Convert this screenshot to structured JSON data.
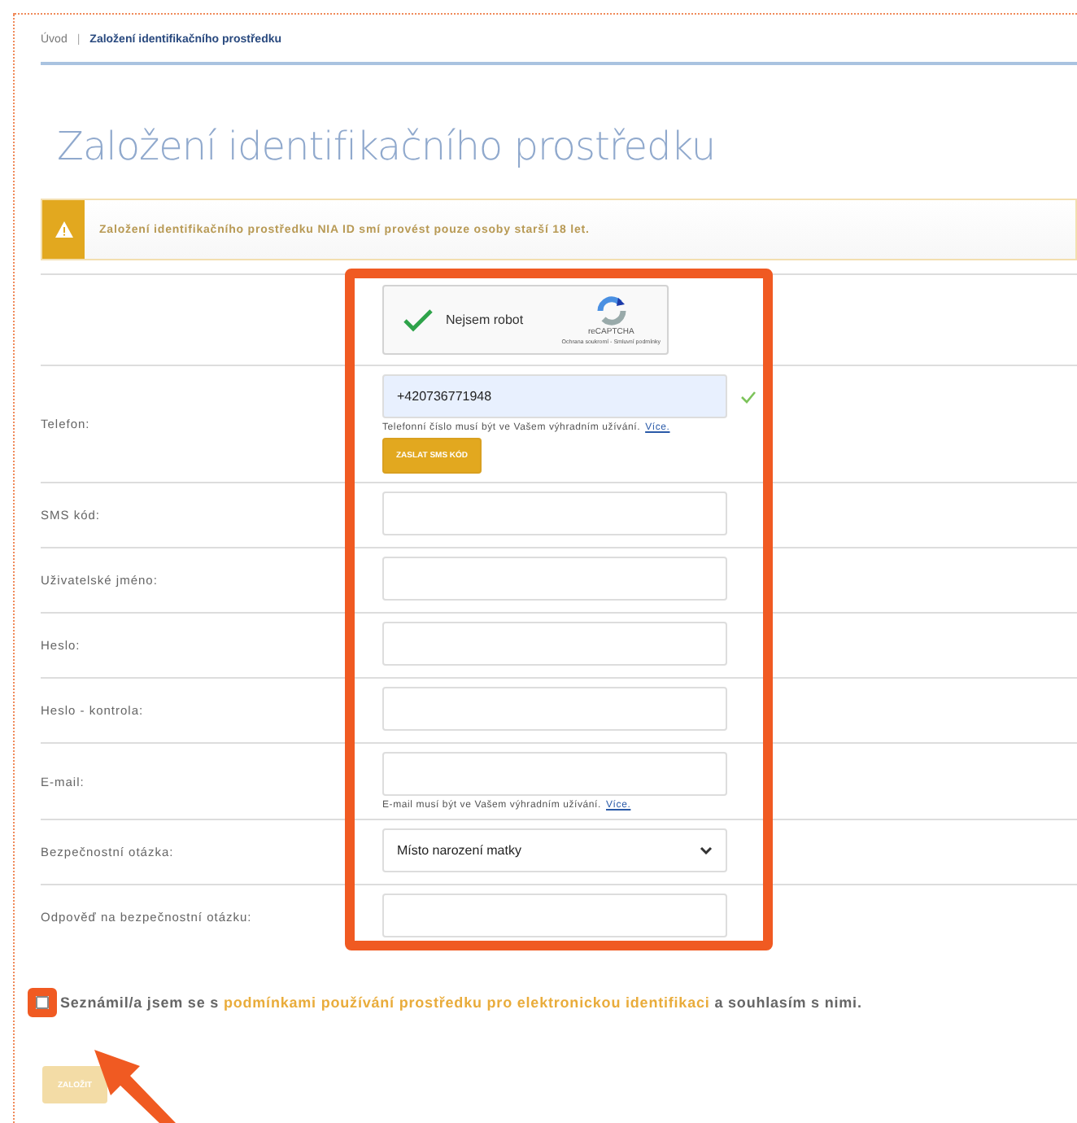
{
  "breadcrumb": [
    {
      "label": "Úvod",
      "selected": false
    },
    {
      "label": "Založení identifikačního prostředku",
      "selected": true
    }
  ],
  "breadcrumb_separator": "|",
  "title": "Založení identifikačního prostředku",
  "alert": {
    "text": "Založení identifikačního prostředku NIA ID smí provést pouze osoby starší 18 let."
  },
  "captcha": {
    "checked": true,
    "label": "Nejsem robot",
    "brand": "reCAPTCHA",
    "links": "Ochrana soukromí - Smluvní podmínky"
  },
  "fields": [
    {
      "kind": "text",
      "label": "Telefon:",
      "value": "+420736771948",
      "valid": true,
      "hint": "Telefonní číslo musí být ve Vašem výhradním užívání.",
      "hint_link": "Více.",
      "button": "ZASLAT SMS KÓD"
    },
    {
      "kind": "text",
      "label": "SMS kód:"
    },
    {
      "kind": "text",
      "label": "Uživatelské jméno:"
    },
    {
      "kind": "text",
      "label": "Heslo:"
    },
    {
      "kind": "text",
      "label": "Heslo - kontrola:"
    },
    {
      "kind": "text",
      "label": "E-mail:",
      "hint": "E-mail musí být ve Vašem výhradním užívání.",
      "hint_link": "Více."
    },
    {
      "kind": "select",
      "label": "Bezpečnostní otázka:",
      "value": "Místo narození matky"
    },
    {
      "kind": "text",
      "label": "Odpověď na bezpečnostní otázku:"
    }
  ],
  "consent": {
    "checked": false,
    "before": "Seznámil/a jsem se s",
    "link": "podmínkami používání prostředku pro elektronickou identifikaci",
    "after": "a souhlasím s nimi."
  },
  "submit": {
    "label": "ZALOŽIT",
    "disabled": true
  }
}
